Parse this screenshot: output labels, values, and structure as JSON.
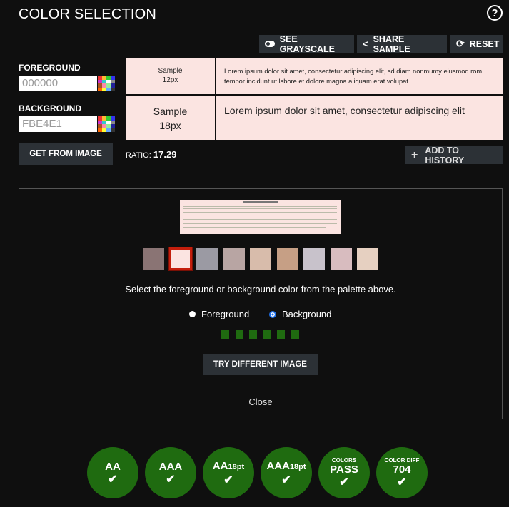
{
  "header": {
    "title": "COLOR SELECTION",
    "help_icon": "?"
  },
  "toolbar": {
    "see_grayscale": "SEE GRAYSCALE",
    "share_sample": "SHARE SAMPLE",
    "reset": "RESET",
    "add_to_history": "ADD TO HISTORY"
  },
  "foreground": {
    "label": "FOREGROUND",
    "value": "000000"
  },
  "background": {
    "label": "BACKGROUND",
    "value": "FBE4E1"
  },
  "get_from_image": "GET FROM IMAGE",
  "ratio": {
    "label": "RATIO:",
    "value": "17.29"
  },
  "samples": {
    "small_label_1": "Sample",
    "small_label_2": "12px",
    "small_text": "Lorem ipsum dolor sit amet, consectetur adipiscing elit, sd diam nonmumy eiusmod rom tempor incidunt ut lsbore et dolore magna aliquam erat volupat.",
    "large_label_1": "Sample",
    "large_label_2": "18px",
    "large_text": "Lorem ipsum dolor sit amet, consectetur adipiscing elit"
  },
  "image_picker": {
    "instructions": "Select the foreground or background color from the palette above.",
    "radio_foreground": "Foreground",
    "radio_background": "Background",
    "selected": "Background",
    "try_different": "TRY DIFFERENT IMAGE",
    "close": "Close",
    "palette": [
      "#8a7474",
      "#fbe4e1",
      "#9b9aa3",
      "#b8a5a3",
      "#d8bcab",
      "#c69f85",
      "#c8c2cb",
      "#d8bcbf",
      "#e6d0c1"
    ]
  },
  "results": [
    {
      "small": "",
      "big": "AA",
      "sub": ""
    },
    {
      "small": "",
      "big": "AAA",
      "sub": ""
    },
    {
      "small": "",
      "big": "AA",
      "sub": "18pt"
    },
    {
      "small": "",
      "big": "AAA",
      "sub": "18pt"
    },
    {
      "small": "COLORS",
      "big": "PASS",
      "sub": ""
    },
    {
      "small": "COLOR DIFF",
      "big": "704",
      "sub": ""
    }
  ],
  "colors": {
    "accent_green": "#1f6b10",
    "sample_bg": "#fbe4e1",
    "button": "#2c3136"
  }
}
